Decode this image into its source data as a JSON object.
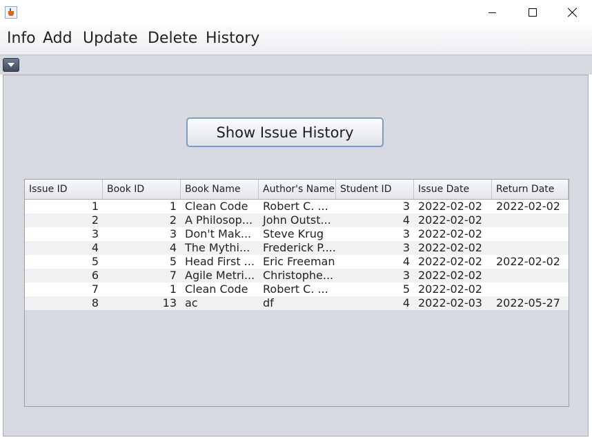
{
  "window": {
    "icon": "java-cup-icon",
    "controls": [
      "minimize-icon",
      "maximize-icon",
      "close-icon"
    ]
  },
  "menu": [
    "Info",
    "Add",
    "Update",
    "Delete",
    "History"
  ],
  "show_button": "Show Issue History",
  "table": {
    "columns": [
      "Issue ID",
      "Book ID",
      "Book Name",
      "Author's Name",
      "Student ID",
      "Issue Date",
      "Return Date"
    ],
    "rows": [
      [
        "1",
        "1",
        " Clean Code",
        "Robert C. ...",
        "3",
        "2022-02-02",
        "2022-02-02"
      ],
      [
        "2",
        "2",
        " A Philosop...",
        "John Outst...",
        "4",
        "2022-02-02",
        ""
      ],
      [
        "3",
        "3",
        "Don't Mak...",
        "Steve Krug",
        "3",
        "2022-02-02",
        ""
      ],
      [
        "4",
        "4",
        " The Mythi...",
        "Frederick P....",
        "3",
        "2022-02-02",
        ""
      ],
      [
        "5",
        "5",
        "Head First ...",
        "Eric Freeman",
        "4",
        "2022-02-02",
        "2022-02-02"
      ],
      [
        "6",
        "7",
        "Agile Metri...",
        "Christophe...",
        "3",
        "2022-02-02",
        ""
      ],
      [
        "7",
        "1",
        " Clean Code",
        "Robert C. ...",
        "5",
        "2022-02-02",
        ""
      ],
      [
        "8",
        "13",
        "ac",
        "df",
        "4",
        "2022-02-03",
        "2022-05-27"
      ]
    ]
  }
}
